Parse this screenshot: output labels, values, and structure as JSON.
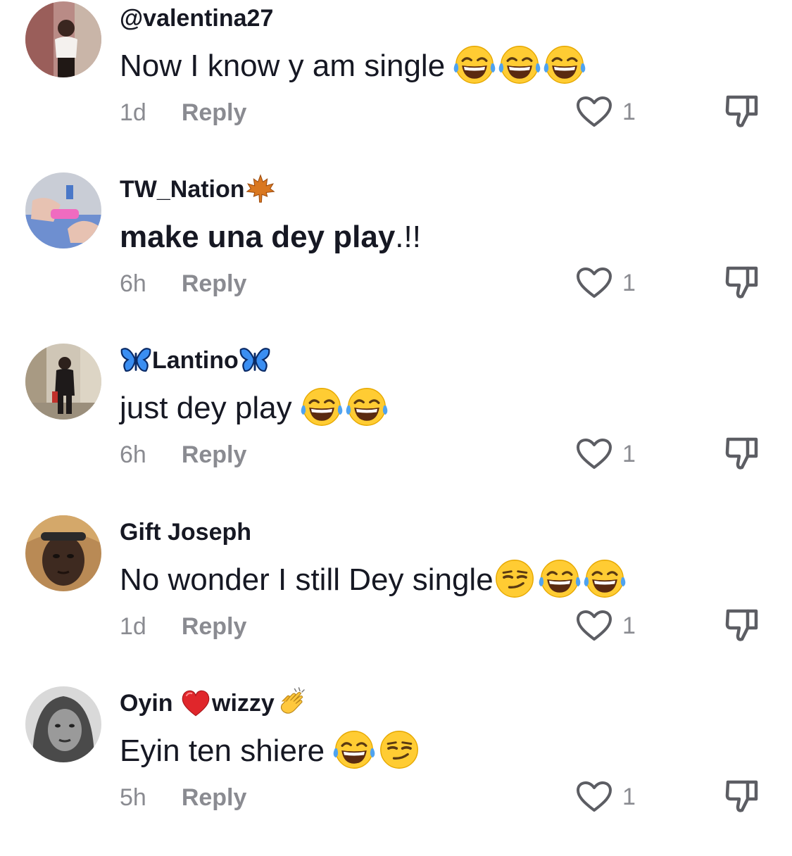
{
  "comments": [
    {
      "username": "@valentina27",
      "text": "Now I know y am single ",
      "text_emojis": [
        "face-with-tears-of-joy-emoji",
        "face-with-tears-of-joy-emoji",
        "face-with-tears-of-joy-emoji"
      ],
      "time": "1d",
      "reply_label": "Reply",
      "likes": "1"
    },
    {
      "username": "TW_Nation",
      "username_suffix_emoji": "maple-leaf-emoji",
      "text": "make una dey play",
      "text_suffix": ".!!",
      "time": "6h",
      "reply_label": "Reply",
      "likes": "1"
    },
    {
      "username": "Lantino",
      "username_prefix_emoji": "butterfly-emoji",
      "username_suffix_emoji": "butterfly-emoji",
      "text": "just dey play ",
      "text_emojis": [
        "face-with-tears-of-joy-emoji",
        "face-with-tears-of-joy-emoji"
      ],
      "time": "6h",
      "reply_label": "Reply",
      "likes": "1"
    },
    {
      "username": "Gift Joseph",
      "text": "No wonder I still Dey single",
      "text_emojis": [
        "smirking-face-emoji",
        "face-with-tears-of-joy-emoji",
        "face-with-tears-of-joy-emoji"
      ],
      "time": "1d",
      "reply_label": "Reply",
      "likes": "1"
    },
    {
      "username_part1": "Oyin ",
      "username_mid_emoji": "red-heart-emoji",
      "username_part2": "wizzy",
      "username_suffix_emoji": "clapping-hands-emoji",
      "text": "Eyin ten shiere ",
      "text_emojis": [
        "face-with-tears-of-joy-emoji",
        "smirking-face-emoji"
      ],
      "time": "5h",
      "reply_label": "Reply",
      "likes": "1"
    }
  ],
  "icons": {
    "like": "heart-outline-icon",
    "dislike": "thumbs-down-outline-icon"
  },
  "colors": {
    "text_primary": "#161823",
    "text_secondary": "#8a8b91",
    "icon": "#5c5d63"
  }
}
